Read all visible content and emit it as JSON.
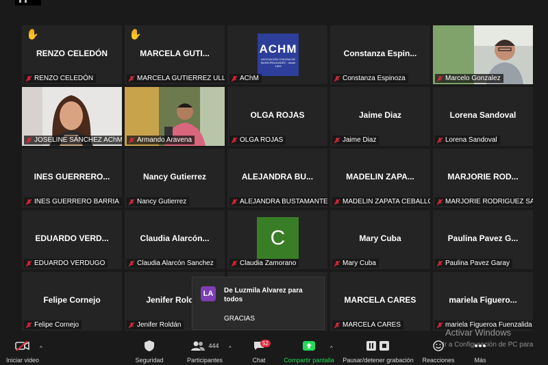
{
  "tiles": [
    {
      "big": "RENZO CELEDÓN",
      "name": "RENZO CELEDÓN",
      "hand": true
    },
    {
      "big": "MARCELA  GUTI...",
      "name": "MARCELA GUTIERREZ ULL...",
      "hand": true
    },
    {
      "logo_text": "ACHM",
      "logo_sub": "ASOCIACIÓN CHILENA DE MUNICIPALIDADES · desde 1993",
      "name": "AChM"
    },
    {
      "big": "Constanza  Espin...",
      "name": "Constanza Espinoza"
    },
    {
      "name": "Marcelo Gonzalez",
      "video": true,
      "speaking": true
    },
    {
      "name": "JOSELINE SÁNCHEZ AChM",
      "video": true
    },
    {
      "name": "Armando Aravena",
      "video": true
    },
    {
      "big": "OLGA ROJAS",
      "name": "OLGA ROJAS"
    },
    {
      "big": "Jaime Diaz",
      "name": "Jaime Diaz"
    },
    {
      "big": "Lorena Sandoval",
      "name": "Lorena Sandoval"
    },
    {
      "big": "INES  GUERRERO...",
      "name": "INES GUERRERO BARRIA"
    },
    {
      "big": "Nancy Gutierrez",
      "name": "Nancy Gutierrez"
    },
    {
      "big": "ALEJANDRA  BU...",
      "name": "ALEJANDRA BUSTAMANTE"
    },
    {
      "big": "MADELIN  ZAPA...",
      "name": "MADELIN ZAPATA CEBALLOS"
    },
    {
      "big": "MARJORIE  ROD...",
      "name": "MARJORIE RODRIGUEZ SA..."
    },
    {
      "big": "EDUARDO  VERD...",
      "name": "EDUARDO VERDUGO"
    },
    {
      "big": "Claudia  Alarcón...",
      "name": "Claudia Alarcón Sanchez"
    },
    {
      "avatar": "C",
      "name": "Claudia Zamorano"
    },
    {
      "big": "Mary Cuba",
      "name": "Mary Cuba"
    },
    {
      "big": "Paulina  Pavez  G...",
      "name": "Paulina Pavez Garay"
    },
    {
      "big": "Felipe Cornejo",
      "name": "Felipe Cornejo"
    },
    {
      "big": "Jenifer  Roldán",
      "name": "Jenifer Roldán"
    },
    {
      "big": "",
      "name": ""
    },
    {
      "big": "MARCELA CARES",
      "name": "MARCELA CARES"
    },
    {
      "big": "mariela  Figuero...",
      "name": "mariela Figueroa Fuenzalida"
    }
  ],
  "chat_popup": {
    "initials": "LA",
    "from": "De Luzmila Alvarez para todos",
    "message": "GRACIAS"
  },
  "toolbar": {
    "start_video": "Iniciar video",
    "security": "Seguridad",
    "participants": "Participantes",
    "participants_count": "444",
    "chat": "Chat",
    "chat_badge": "52",
    "share_screen": "Compartir pantalla",
    "pause_recording": "Pausar/detener grabación",
    "reactions": "Reacciones",
    "more": "Más"
  },
  "watermark": {
    "title": "Activar Windows",
    "subtitle": "Ir a Configuración de PC para"
  },
  "colors": {
    "background": "#1a1a1a",
    "tile": "#242424",
    "active_speaker": "#b5d94a",
    "mute_red": "#e0283c",
    "share_green": "#23d959",
    "chat_badge_purple": "#7d3fb3"
  }
}
